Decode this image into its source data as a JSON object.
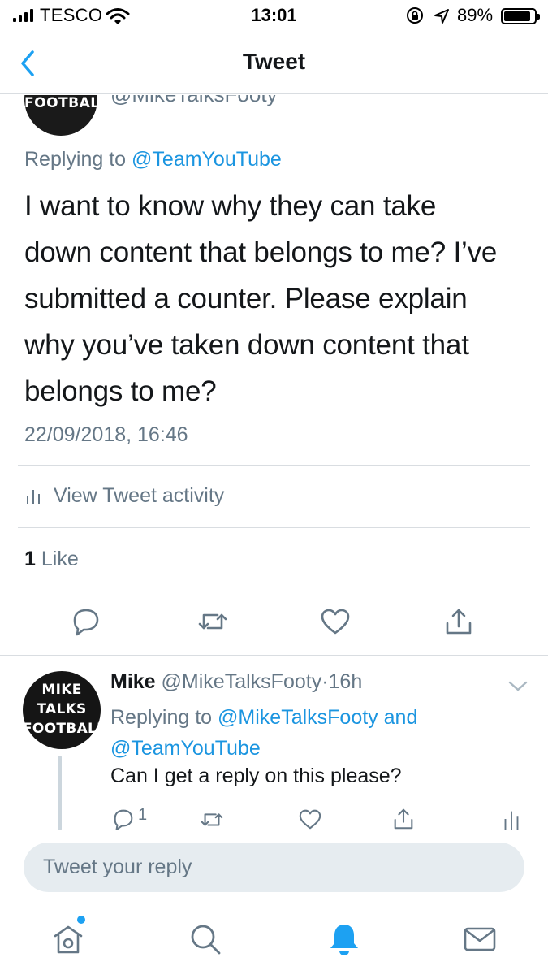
{
  "status_bar": {
    "carrier": "TESCO",
    "time": "13:01",
    "battery_percent": "89%",
    "battery_level": 0.89,
    "icons": [
      "signal-icon",
      "wifi-icon",
      "rotation-lock-icon",
      "location-arrow-icon",
      "battery-icon"
    ]
  },
  "nav": {
    "title": "Tweet",
    "back_icon": "chevron-left-icon"
  },
  "main_tweet": {
    "avatar_text": "FOOTBALL",
    "handle_partial": "@MikeTalksFooty",
    "replying_prefix": "Replying to",
    "replying_to": "@TeamYouTube",
    "lines": [
      "I want to know why they can take",
      "down content that belongs to me? I’ve",
      "submitted a counter. Please explain",
      "why you’ve taken down content that",
      "belongs to me?"
    ],
    "timestamp": "22/09/2018, 16:46",
    "activity_label": "View Tweet activity",
    "like_count": "1",
    "like_label": "Like",
    "actions": [
      "reply-icon",
      "retweet-icon",
      "like-icon",
      "share-icon"
    ]
  },
  "reply_tweet": {
    "avatar_lines": [
      "MIKE",
      "TALKS",
      "FOOTBALL"
    ],
    "name": "Mike",
    "handle": "@MikeTalksFooty",
    "separator": "·",
    "time_ago": "16h",
    "replying_prefix": "Replying to",
    "replying_to_1": "@MikeTalksFooty",
    "replying_and": "and",
    "replying_to_2": "@TeamYouTube",
    "text": "Can I get a reply on this please?",
    "reply_count": "1"
  },
  "composer": {
    "placeholder": "Tweet your reply"
  },
  "tabbar": {
    "tabs": [
      "home-icon",
      "search-icon",
      "notifications-icon",
      "messages-icon"
    ],
    "active_tab": "notifications-icon",
    "accent": "#1da1f2"
  },
  "colors": {
    "link": "#1b95e0",
    "secondary_text": "#657786",
    "divider": "#d9dde1"
  }
}
